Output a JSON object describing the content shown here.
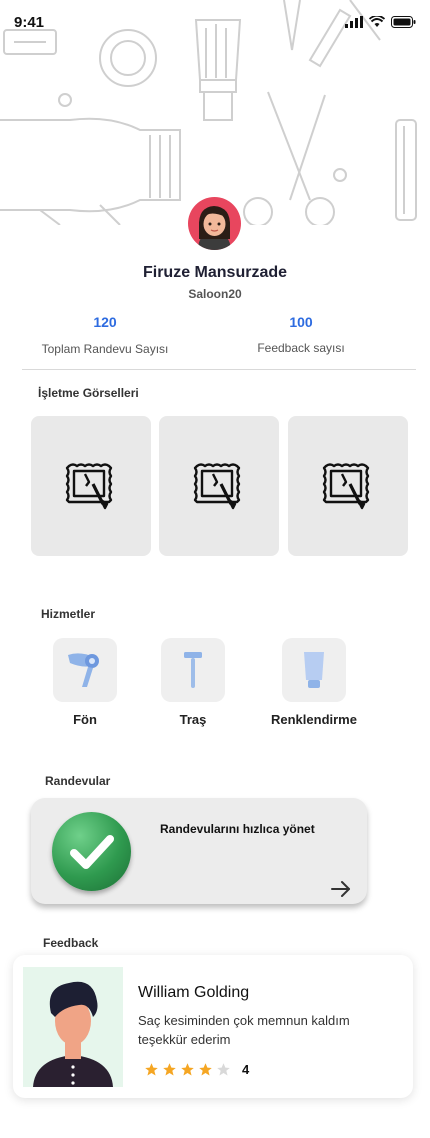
{
  "status_bar": {
    "time": "9:41"
  },
  "profile": {
    "name": "Firuze Mansurzade",
    "salon": "Saloon20"
  },
  "stats": [
    {
      "value": "120",
      "label": "Toplam Randevu Sayısı"
    },
    {
      "value": "100",
      "label": "Feedback sayısı"
    }
  ],
  "gallery": {
    "title": "İşletme Görselleri",
    "icon": "image-placeholder-icon"
  },
  "services": {
    "title": "Hizmetler",
    "items": [
      {
        "label": "Fön",
        "icon": "hair-dryer-icon"
      },
      {
        "label": "Traş",
        "icon": "razor-icon"
      },
      {
        "label": "Renklendirme",
        "icon": "hair-dye-tube-icon"
      }
    ]
  },
  "appointments": {
    "title": "Randevular",
    "card_text": "Randevularını hızlıca yönet",
    "icon": "check-icon"
  },
  "feedback": {
    "title": "Feedback",
    "name": "William Golding",
    "text": "Saç kesiminden çok memnun kaldım teşekkür ederim",
    "rating": "4",
    "rating_value": 4,
    "rating_max": 5
  },
  "colors": {
    "accent": "#2d6be0",
    "star": "#f5a623",
    "star_empty": "#d9d9d9",
    "check_green": "#2f9a4f"
  }
}
